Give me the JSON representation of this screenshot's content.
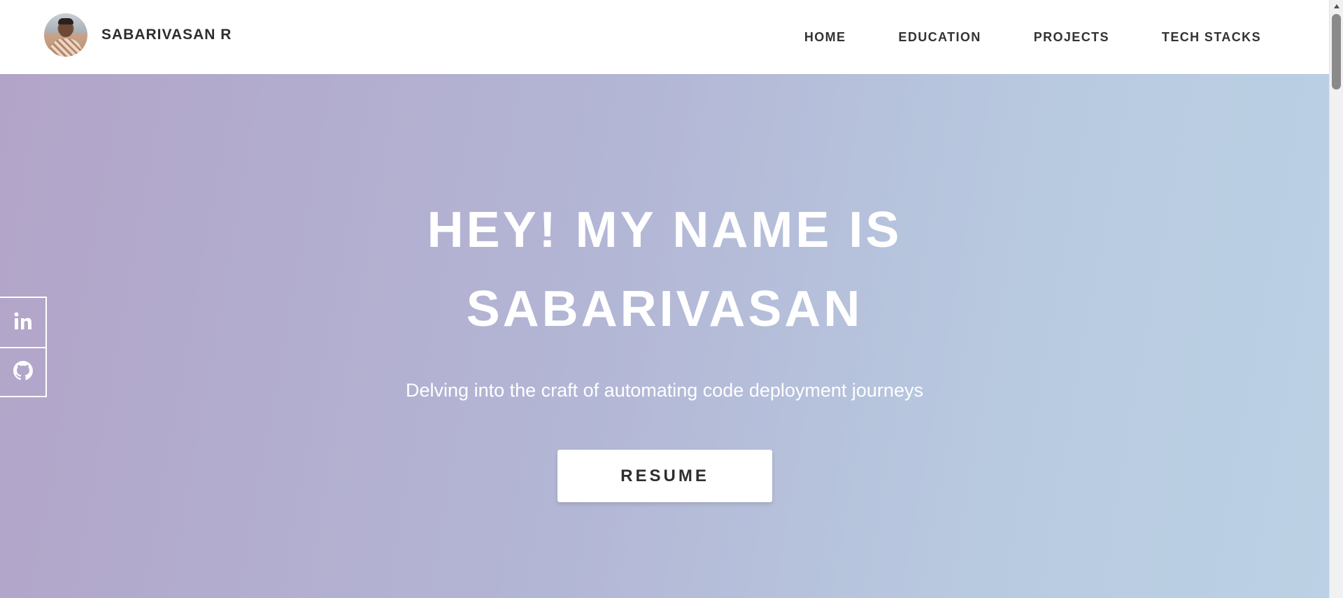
{
  "header": {
    "brand_name": "SABARIVASAN R",
    "nav": [
      {
        "label": "HOME"
      },
      {
        "label": "EDUCATION"
      },
      {
        "label": "PROJECTS"
      },
      {
        "label": "TECH STACKS"
      }
    ]
  },
  "hero": {
    "title_line1": "HEY! MY NAME IS",
    "title_line2": "SABARIVASAN",
    "subtitle": "Delving into the craft of automating code deployment journeys",
    "resume_label": "RESUME"
  },
  "social": {
    "items": [
      {
        "icon": "linkedin-icon"
      },
      {
        "icon": "github-icon"
      }
    ]
  },
  "colors": {
    "gradient_start": "#b2a4c8",
    "gradient_mid": "#b3b6d5",
    "gradient_end": "#bcd1e5",
    "header_bg": "#ffffff",
    "text_dark": "#2e2e2e",
    "text_light": "#ffffff"
  }
}
